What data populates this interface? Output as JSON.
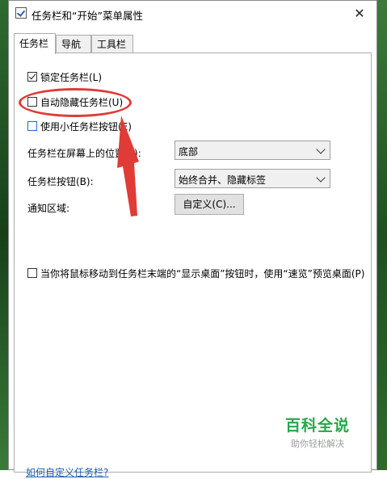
{
  "window": {
    "title": "任务栏和“开始”菜单属性",
    "close_glyph": "✕"
  },
  "tabs": [
    {
      "label": "任务栏",
      "active": true
    },
    {
      "label": "导航",
      "active": false
    },
    {
      "label": "工具栏",
      "active": false
    }
  ],
  "options": {
    "lock_taskbar": {
      "label": "锁定任务栏(L)",
      "checked": true
    },
    "auto_hide": {
      "label": "自动隐藏任务栏(U)",
      "checked": false
    },
    "small_buttons": {
      "label": "使用小任务栏按钮(E)",
      "checked": false
    },
    "peek": {
      "label": "当你将鼠标移动到任务栏末端的“显示桌面”按钮时，使用“速览”预览桌面(P)",
      "checked": false
    }
  },
  "fields": {
    "location": {
      "label": "任务栏在屏幕上的位置(T):",
      "value": "底部"
    },
    "buttons": {
      "label": "任务栏按钮(B):",
      "value": "始终合并、隐藏标签"
    },
    "notification": {
      "label": "通知区域:",
      "button_label": "自定义(C)..."
    }
  },
  "footer": {
    "link_text": "如何自定义任务栏?"
  },
  "watermark": {
    "title": "百科全说",
    "subtitle": "助你轻松解决"
  },
  "colors": {
    "annotation": "#e03b36",
    "brand_green": "#27a64a",
    "link": "#1a5fb4"
  }
}
